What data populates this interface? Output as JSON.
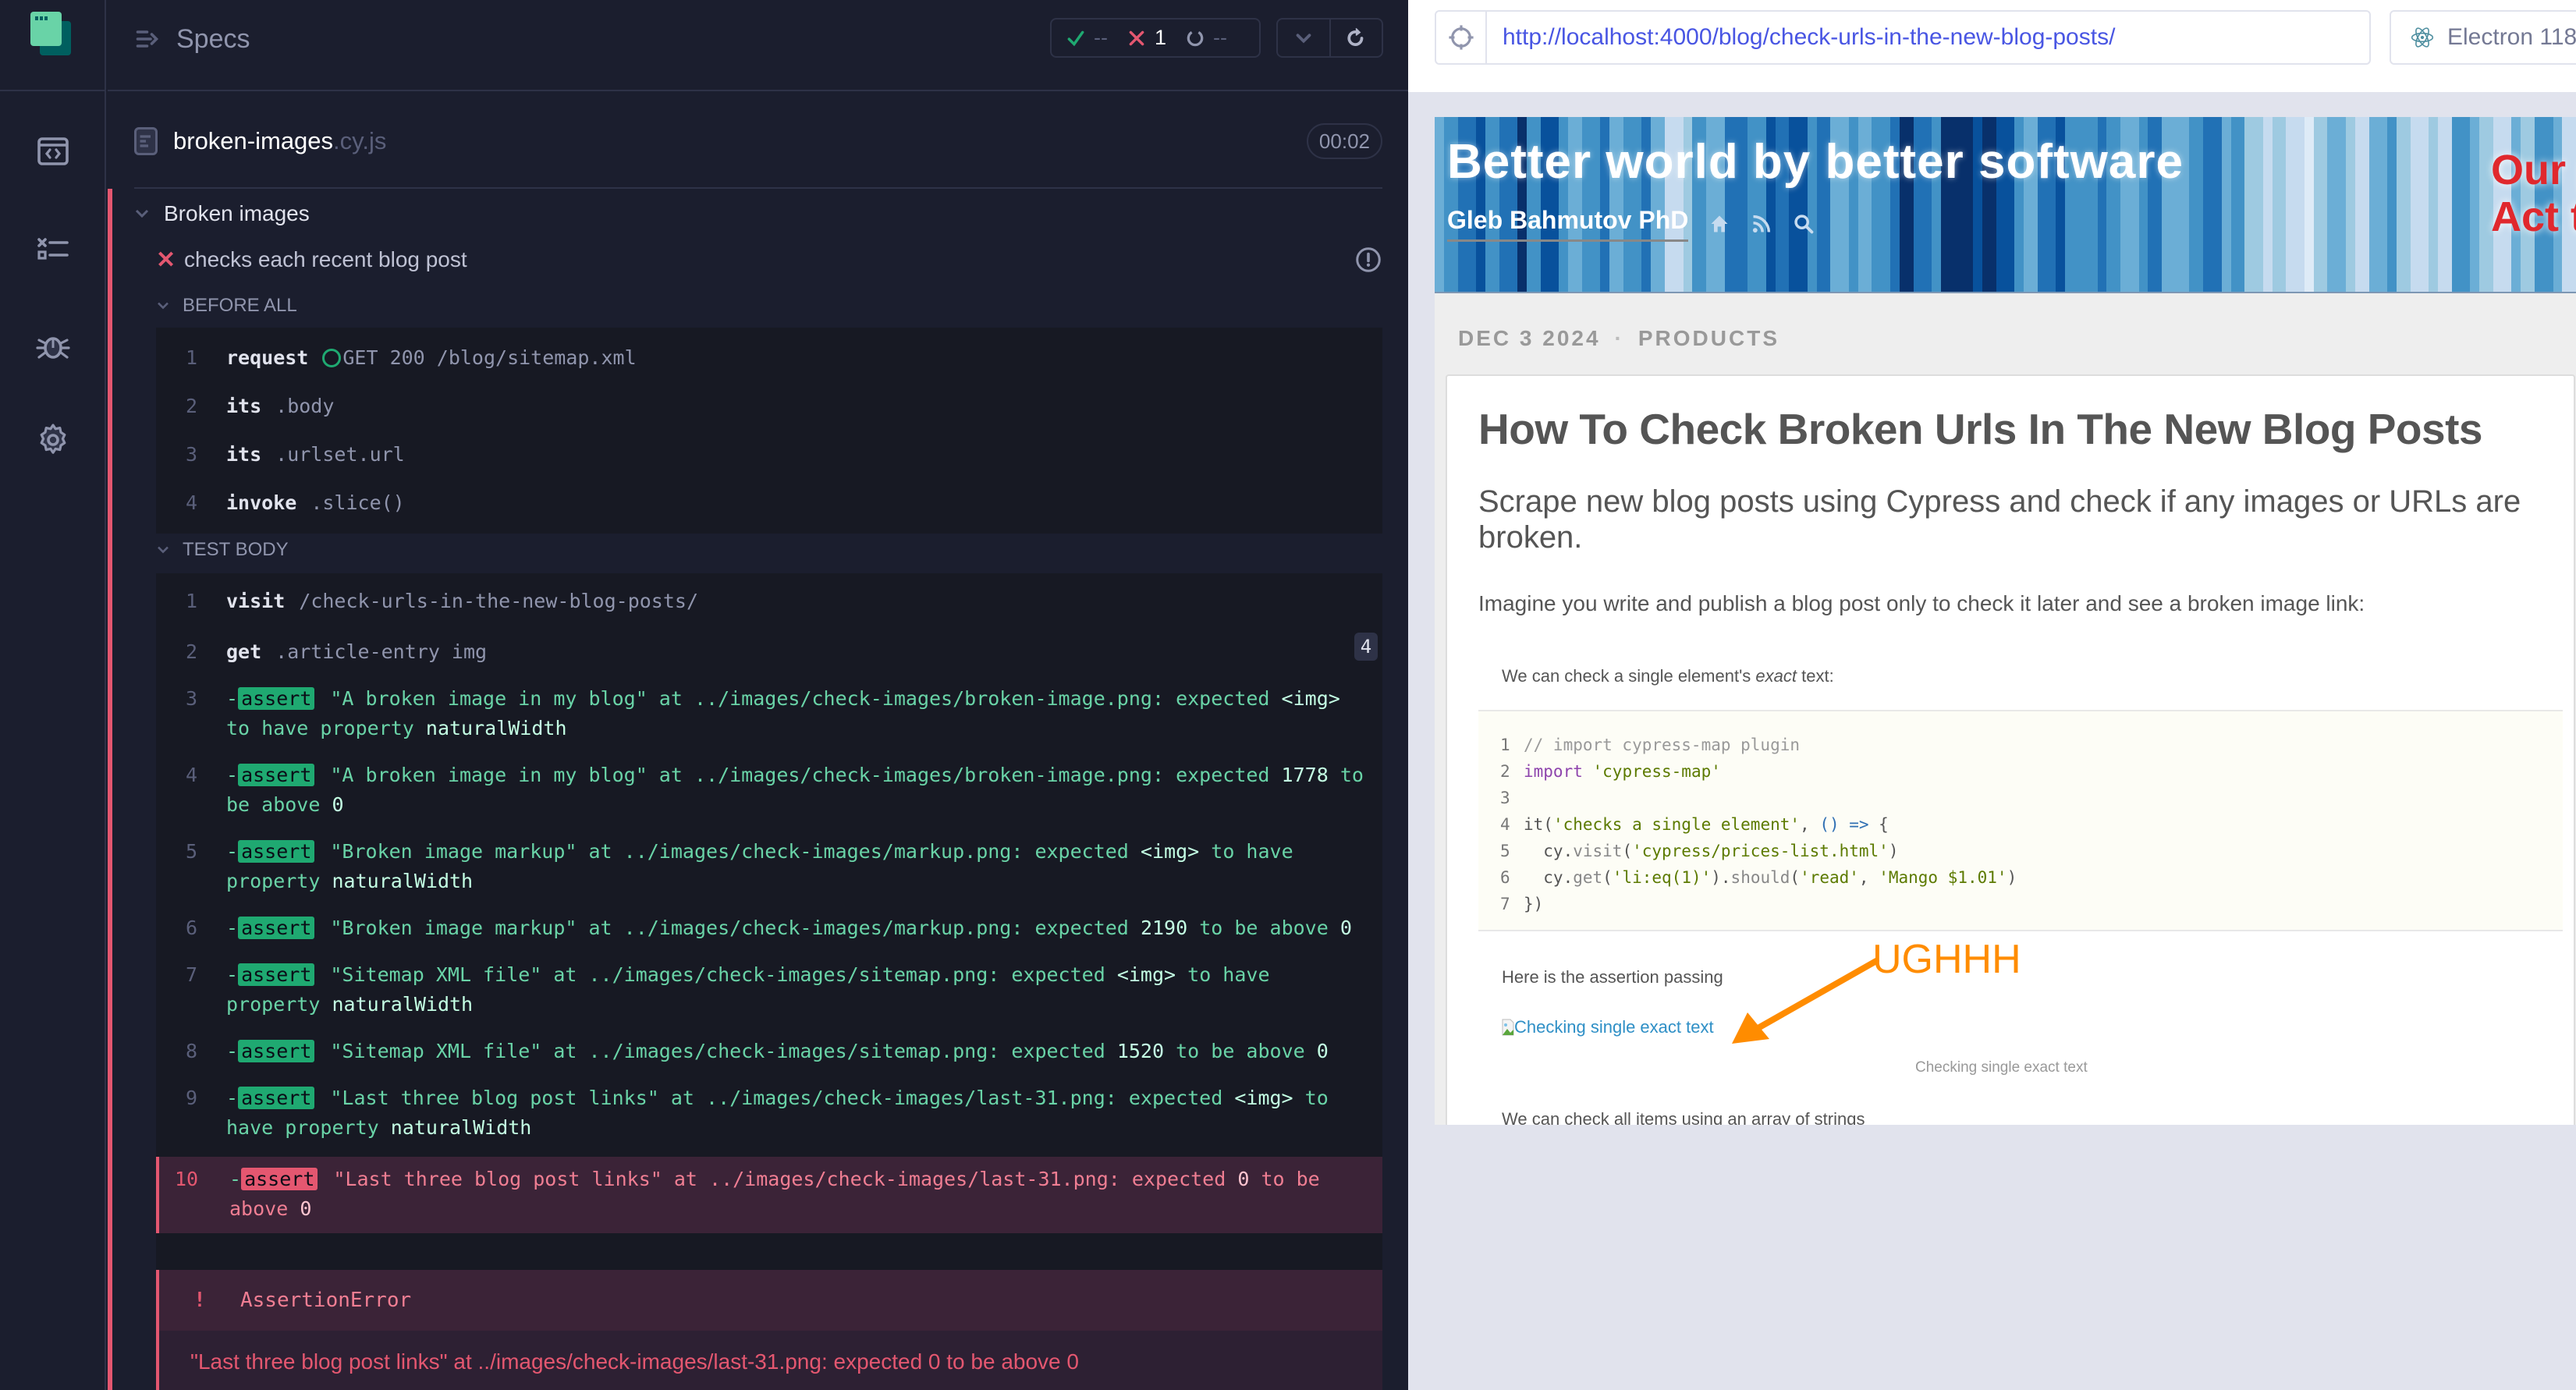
{
  "sidebar": {
    "items": [
      {
        "id": "specs",
        "icon": "code-window-icon"
      },
      {
        "id": "runs",
        "icon": "test-list-icon"
      },
      {
        "id": "debug",
        "icon": "bug-icon"
      },
      {
        "id": "settings",
        "icon": "gear-icon"
      }
    ]
  },
  "reporter": {
    "specs_label": "Specs",
    "stats": {
      "passed": "--",
      "failed": "1",
      "pending": "--"
    },
    "file": {
      "name": "broken-images",
      "ext": ".cy.js",
      "duration": "00:02"
    },
    "suite_title": "Broken images",
    "test_title": "checks each recent blog post",
    "before_all": {
      "label": "BEFORE ALL",
      "commands": [
        {
          "n": "1",
          "name": "request",
          "msg": "GET 200 /blog/sitemap.xml"
        },
        {
          "n": "2",
          "name": "its",
          "msg": ".body"
        },
        {
          "n": "3",
          "name": "its",
          "msg": ".urlset.url"
        },
        {
          "n": "4",
          "name": "invoke",
          "msg": ".slice()"
        }
      ]
    },
    "test_body": {
      "label": "TEST BODY",
      "commands": [
        {
          "n": "1",
          "name": "visit",
          "msg": "/check-urls-in-the-new-blog-posts/"
        },
        {
          "n": "2",
          "name": "get",
          "msg": ".article-entry img",
          "count": "4"
        }
      ],
      "asserts": [
        {
          "n": "3",
          "tag": "assert",
          "text": "\"A broken image in my blog\" at ../images/check-images/broken-image.png: expected",
          "text2": "<img>",
          "text3": "to have property",
          "text4": "naturalWidth"
        },
        {
          "n": "4",
          "tag": "assert",
          "text": "\"A broken image in my blog\" at ../images/check-images/broken-image.png: expected",
          "text2": "1778",
          "text3": "to be above",
          "text4": "0"
        },
        {
          "n": "5",
          "tag": "assert",
          "text": "\"Broken image markup\" at ../images/check-images/markup.png: expected",
          "text2": "<img>",
          "text3": "to have property",
          "text4": "naturalWidth"
        },
        {
          "n": "6",
          "tag": "assert",
          "text": "\"Broken image markup\" at ../images/check-images/markup.png: expected",
          "text2": "2190",
          "text3": "to be above",
          "text4": "0"
        },
        {
          "n": "7",
          "tag": "assert",
          "text": "\"Sitemap XML file\" at ../images/check-images/sitemap.png: expected",
          "text2": "<img>",
          "text3": "to have property",
          "text4": "naturalWidth"
        },
        {
          "n": "8",
          "tag": "assert",
          "text": "\"Sitemap XML file\" at ../images/check-images/sitemap.png: expected",
          "text2": "1520",
          "text3": "to be above",
          "text4": "0"
        },
        {
          "n": "9",
          "tag": "assert",
          "text": "\"Last three blog post links\" at ../images/check-images/last-31.png: expected",
          "text2": "<img>",
          "text3": "to have property",
          "text4": "naturalWidth"
        },
        {
          "n": "10",
          "tag": "assert",
          "text": "\"Last three blog post links\" at ../images/check-images/last-31.png: expected",
          "text2": "0",
          "text3": "to be above",
          "text4": "0",
          "failed": true
        }
      ]
    },
    "error": {
      "bang": "!",
      "name": "AssertionError",
      "message": "\"Last three blog post links\" at ../images/check-images/last-31.png: expected 0 to be above 0"
    }
  },
  "browser": {
    "url": "http://localhost:4000/blog/check-urls-in-the-new-blog-posts/",
    "name": "Electron 118"
  },
  "blog": {
    "site_title": "Better world by better software",
    "author": "Gleb Bahmutov PhD",
    "climate_line1": "Our planet is in danger",
    "climate_line2": "Act today: what you can do",
    "date": "DEC 3 2024",
    "category": "PRODUCTS",
    "sep": "·",
    "title": "How To Check Broken Urls In The New Blog Posts",
    "subtitle": "Scrape new blog posts using Cypress and check if any images or URLs are broken.",
    "intro": "Imagine you write and publish a blog post only to check it later and see a broken image link:",
    "p_single_before": "We can check a single element's ",
    "p_single_em": "exact",
    "p_single_after": " text:",
    "code": [
      {
        "n": "1",
        "html": "<span class='cm'>// import cypress-map plugin</span>"
      },
      {
        "n": "2",
        "html": "<span class='kw'>import</span> <span class='st'>'cypress-map'</span>"
      },
      {
        "n": "3",
        "html": ""
      },
      {
        "n": "4",
        "html": "it(<span class='st'>'checks a single element'</span>, <span class='op'>() =&gt;</span> {"
      },
      {
        "n": "5",
        "html": "  cy.<span class='fn'>visit</span>(<span class='st'>'cypress/prices-list.html'</span>)"
      },
      {
        "n": "6",
        "html": "  cy.<span class='fn'>get</span>(<span class='st'>'li:eq(1)'</span>).<span class='fn'>should</span>(<span class='st'>'read'</span>, <span class='st'>'Mango $1.01'</span>)"
      },
      {
        "n": "7",
        "html": "})"
      }
    ],
    "assertion_passing": "Here is the assertion passing",
    "broken_img_alt": "Checking single exact text",
    "caption": "Checking single exact text",
    "p_array": "We can check all items using an array of strings"
  },
  "annotation": {
    "text": "UGHHH",
    "color": "#ff8c00"
  },
  "colors": {
    "fail": "#e45770",
    "pass": "#1fa971",
    "url": "#4956e3",
    "stripes": [
      "#6baed6",
      "#4292c6",
      "#2171b5",
      "#08519c",
      "#4292c6",
      "#2171b5",
      "#08306b",
      "#4292c6",
      "#08519c",
      "#4292c6",
      "#6baed6",
      "#4292c6",
      "#2171b5",
      "#6baed6",
      "#4292c6",
      "#2171b5",
      "#6baed6",
      "#c6dbef",
      "#9ecae1",
      "#4292c6",
      "#6baed6",
      "#2171b5",
      "#2171b5",
      "#4292c6",
      "#08519c",
      "#2171b5",
      "#08519c",
      "#4292c6",
      "#2171b5",
      "#6baed6",
      "#4292c6",
      "#6baed6",
      "#4292c6",
      "#2171b5",
      "#08306b",
      "#2171b5",
      "#4292c6",
      "#08306b",
      "#08306b",
      "#08519c",
      "#08306b",
      "#08519c",
      "#4292c6",
      "#6baed6",
      "#2171b5",
      "#08519c",
      "#4292c6",
      "#4292c6",
      "#2171b5",
      "#4292c6",
      "#6baed6",
      "#4292c6",
      "#2171b5",
      "#6baed6",
      "#6baed6",
      "#4292c6",
      "#2171b5",
      "#6baed6",
      "#4292c6",
      "#9ecae1",
      "#c6dbef",
      "#9ecae1",
      "#c6dbef",
      "#deebf7",
      "#9ecae1",
      "#6baed6",
      "#9ecae1",
      "#c6dbef",
      "#6baed6",
      "#4292c6",
      "#9ecae1",
      "#c6dbef",
      "#9ecae1",
      "#c6dbef",
      "#4292c6",
      "#6baed6",
      "#9ecae1",
      "#c6dbef",
      "#6baed6",
      "#9ecae1",
      "#4292c6",
      "#6baed6",
      "#c6dbef"
    ]
  }
}
